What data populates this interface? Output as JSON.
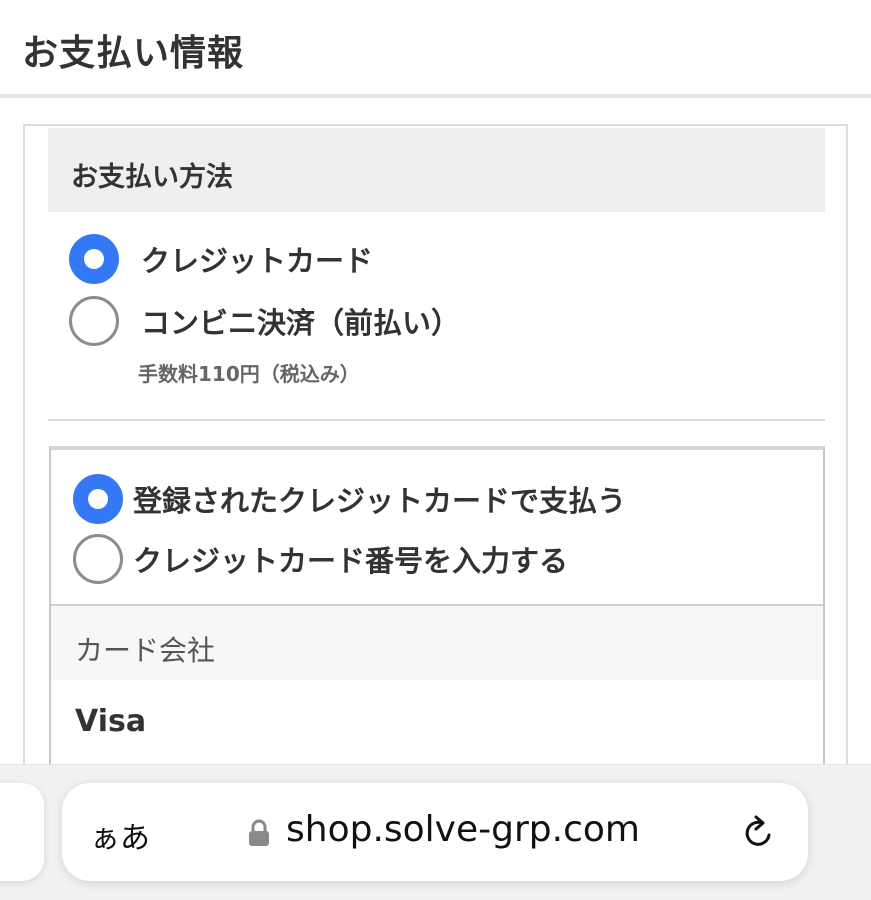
{
  "header": {
    "title": "お支払い情報"
  },
  "payment_method": {
    "section_title": "お支払い方法",
    "options": [
      {
        "label": "クレジットカード",
        "selected": true
      },
      {
        "label": "コンビニ決済（前払い）",
        "selected": false
      }
    ],
    "fee_note": "手数料110円（税込み）"
  },
  "card_options": {
    "options": [
      {
        "label": "登録されたクレジットカードで支払う",
        "selected": true
      },
      {
        "label": "クレジットカード番号を入力する",
        "selected": false
      }
    ],
    "company_label": "カード会社",
    "company_value": "Visa"
  },
  "browser": {
    "text_size_label": "ぁあ",
    "url": "shop.solve-grp.com",
    "icons": {
      "lock": "lock-icon",
      "reload": "reload-icon"
    }
  },
  "colors": {
    "accent": "#3478f6",
    "section_bg": "#efefef",
    "text": "#333333",
    "muted": "#666666",
    "border": "#dcdcdc",
    "browser_bar": "#f1f1f1"
  }
}
